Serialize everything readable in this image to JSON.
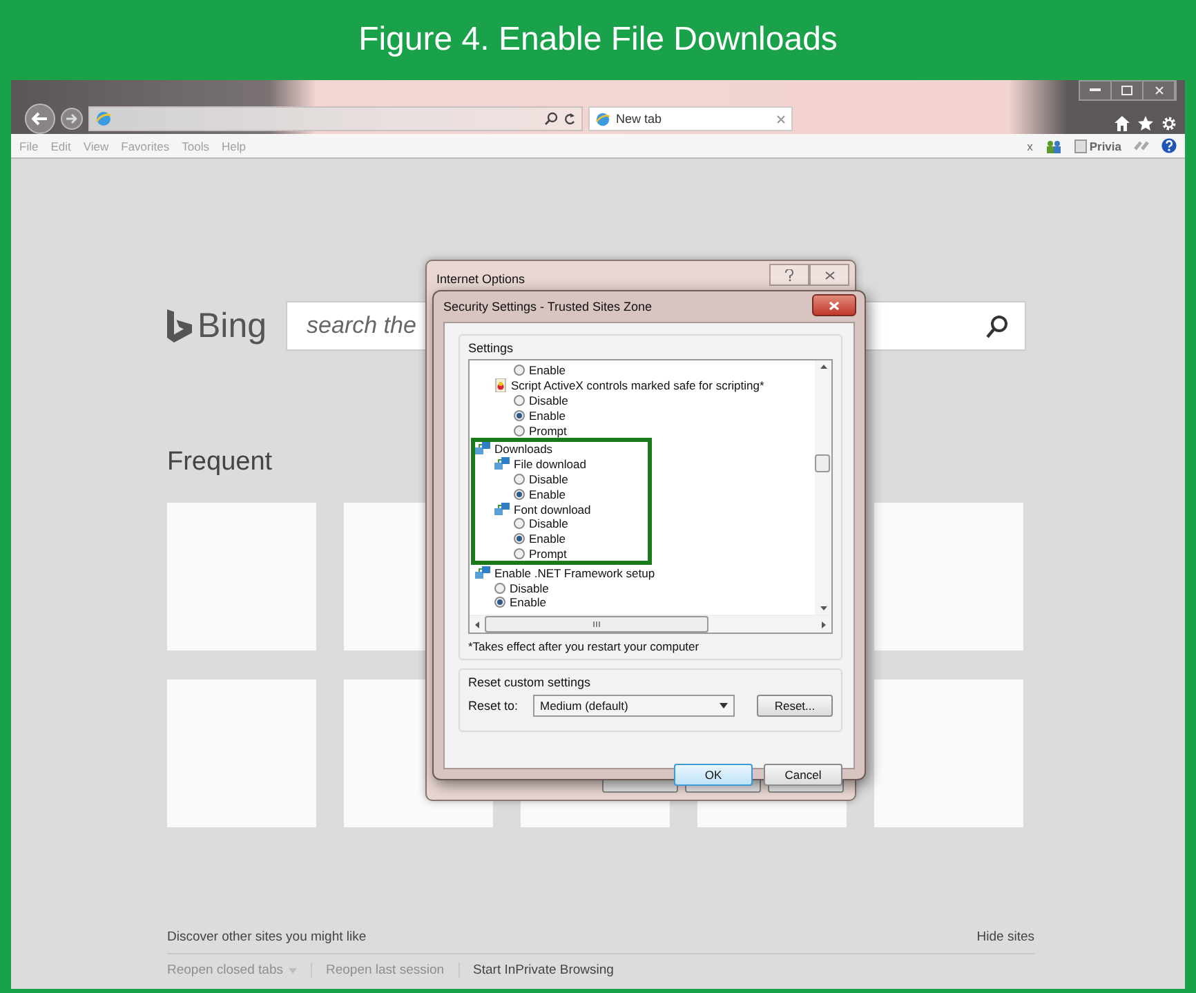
{
  "figure": {
    "title": "Figure 4. Enable File Downloads"
  },
  "tab": {
    "label": "New tab"
  },
  "menu_bar": [
    "File",
    "Edit",
    "View",
    "Favorites",
    "Tools",
    "Help"
  ],
  "toolbar": {
    "close_mark": "x",
    "label": "Privia"
  },
  "new_tab_page": {
    "logo_text": "Bing",
    "search": {
      "placeholder": "search the"
    },
    "frequent_heading": "Frequent",
    "discover": "Discover other sites you might like",
    "hide_sites": "Hide sites",
    "bottom_links": [
      {
        "label": "Reopen closed tabs",
        "disabled": true,
        "kind": "dropdown"
      },
      {
        "label": "Reopen last session",
        "disabled": true,
        "kind": "link"
      },
      {
        "label": "Start InPrivate Browsing",
        "disabled": false,
        "kind": "link"
      }
    ]
  },
  "back_dialog": {
    "title": "Internet Options"
  },
  "dialog": {
    "title": "Security Settings - Trusted Sites Zone",
    "settings_label": "Settings",
    "items": [
      {
        "children": [
          {
            "children": [
              {
                "kind": "radio",
                "label": "Enable",
                "selected": false
              }
            ]
          },
          {
            "kind": "script",
            "label": "Script ActiveX controls marked safe for scripting*",
            "children": [
              {
                "kind": "radio",
                "label": "Disable",
                "selected": false
              },
              {
                "kind": "radio",
                "label": "Enable",
                "selected": true
              },
              {
                "kind": "radio",
                "label": "Prompt",
                "selected": false
              }
            ]
          }
        ]
      },
      {
        "kind": "setting",
        "label": "Downloads",
        "highlighted": true,
        "children": [
          {
            "kind": "setting",
            "label": "File download",
            "children": [
              {
                "kind": "radio",
                "label": "Disable",
                "selected": false
              },
              {
                "kind": "radio",
                "label": "Enable",
                "selected": true
              }
            ]
          },
          {
            "kind": "setting",
            "label": "Font download",
            "children": [
              {
                "kind": "radio",
                "label": "Disable",
                "selected": false
              },
              {
                "kind": "radio",
                "label": "Enable",
                "selected": true
              },
              {
                "kind": "radio",
                "label": "Prompt",
                "selected": false
              }
            ]
          }
        ]
      },
      {
        "kind": "setting",
        "label": "Enable .NET Framework setup",
        "children": [
          {
            "kind": "radio",
            "label": "Disable",
            "selected": false
          },
          {
            "kind": "radio",
            "label": "Enable",
            "selected": true
          }
        ]
      }
    ],
    "note": "*Takes effect after you restart your computer",
    "reset_group": "Reset custom settings",
    "reset_to_label": "Reset to:",
    "reset_to_value": "Medium (default)",
    "reset_button": "Reset...",
    "buttons": [
      {
        "label": "OK",
        "default": true
      },
      {
        "label": "Cancel",
        "default": false
      }
    ]
  }
}
